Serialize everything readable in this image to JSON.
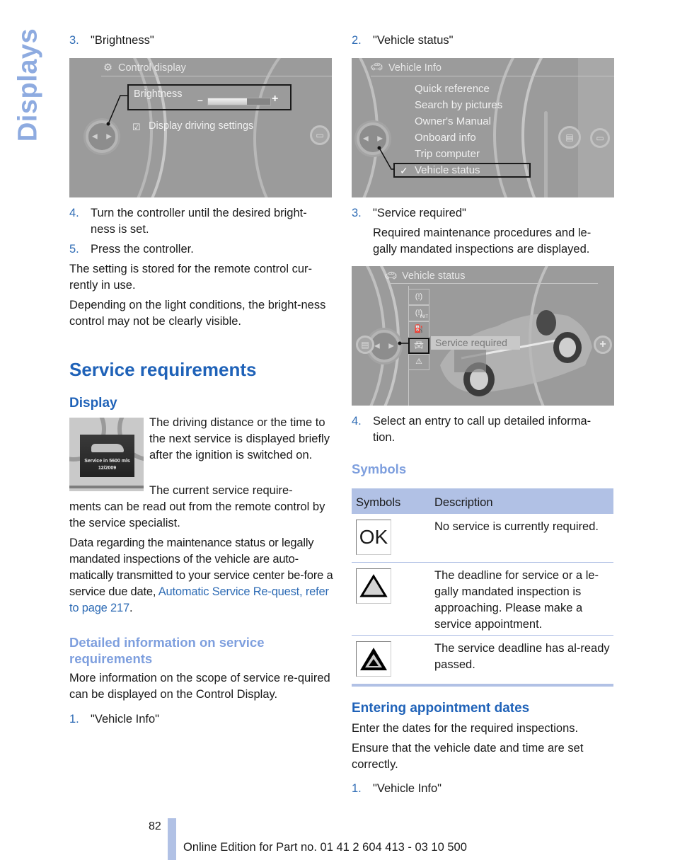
{
  "side_tab": "Displays",
  "left_column": {
    "step3": {
      "num": "3.",
      "text": "\"Brightness\""
    },
    "screen1": {
      "title": "Control display",
      "brightness_label": "Brightness",
      "minus": "–",
      "plus": "+",
      "brightness_level_fraction": 0.62,
      "checkbox_label": "Display driving settings",
      "checkbox_checked": true
    },
    "step4": {
      "num": "4.",
      "text": "Turn the controller until the desired bright-ness is set."
    },
    "step5": {
      "num": "5.",
      "text": "Press the controller."
    },
    "para1": "The setting is stored for the remote control cur-rently in use.",
    "para2": "Depending on the light conditions, the bright-ness control may not be clearly visible.",
    "section_title": "Service requirements",
    "display_heading": "Display",
    "cluster_image": {
      "line1": "Service in 5600 mls",
      "line2": "12/2009"
    },
    "display_text1": "The driving distance or the time to the next service is displayed briefly after the ignition is switched on.",
    "display_text2_start": "The current service require-",
    "display_text2_rest": "ments can be read out from the remote control by the service specialist.",
    "para3_text": "Data regarding the maintenance status or legally mandated inspections of the vehicle are auto-matically transmitted to your service center be-fore a service due date,",
    "para3_link": "Automatic Service Re-quest, refer to page 217",
    "para3_end": ".",
    "detail_heading": "Detailed information on service requirements",
    "detail_text": "More information on the scope of service re-quired can be displayed on the Control Display.",
    "step1": {
      "num": "1.",
      "text": "\"Vehicle Info\""
    }
  },
  "right_column": {
    "step2": {
      "num": "2.",
      "text": "\"Vehicle status\""
    },
    "screen2": {
      "title": "Vehicle Info",
      "items": [
        "Quick reference",
        "Search by pictures",
        "Owner's Manual",
        "Onboard info",
        "Trip computer",
        "Vehicle status"
      ],
      "selected_check": "✓"
    },
    "step3": {
      "num": "3.",
      "text": "\"Service required\""
    },
    "step3_desc": "Required maintenance procedures and le-gally mandated inspections are displayed.",
    "screen3": {
      "title": "Vehicle status",
      "tooltip": "Service required",
      "icons": [
        "tire-pressure-icon",
        "tire-pressure-init-icon",
        "oil-icon",
        "service-car-icon",
        "warning-icon"
      ],
      "init_label": "INIT"
    },
    "step4": {
      "num": "4.",
      "text": "Select an entry to call up detailed informa-tion."
    },
    "symbols_heading": "Symbols",
    "table": {
      "headers": [
        "Symbols",
        "Description"
      ],
      "rows": [
        {
          "symbol": "OK",
          "description": "No service is currently required."
        },
        {
          "symbol": "triangle-outline",
          "description": "The deadline for service or a le-gally mandated inspection is approaching. Please make a service appointment."
        },
        {
          "symbol": "triangle-filled",
          "description": "The service deadline has al-ready passed."
        }
      ]
    },
    "appointment_heading": "Entering appointment dates",
    "appointment_text1": "Enter the dates for the required inspections.",
    "appointment_text2": "Ensure that the vehicle date and time are set correctly.",
    "step1": {
      "num": "1.",
      "text": "\"Vehicle Info\""
    }
  },
  "footer": {
    "page_number": "82",
    "edition": "Online Edition for Part no. 01 41 2 604 413 - 03 10 500"
  }
}
